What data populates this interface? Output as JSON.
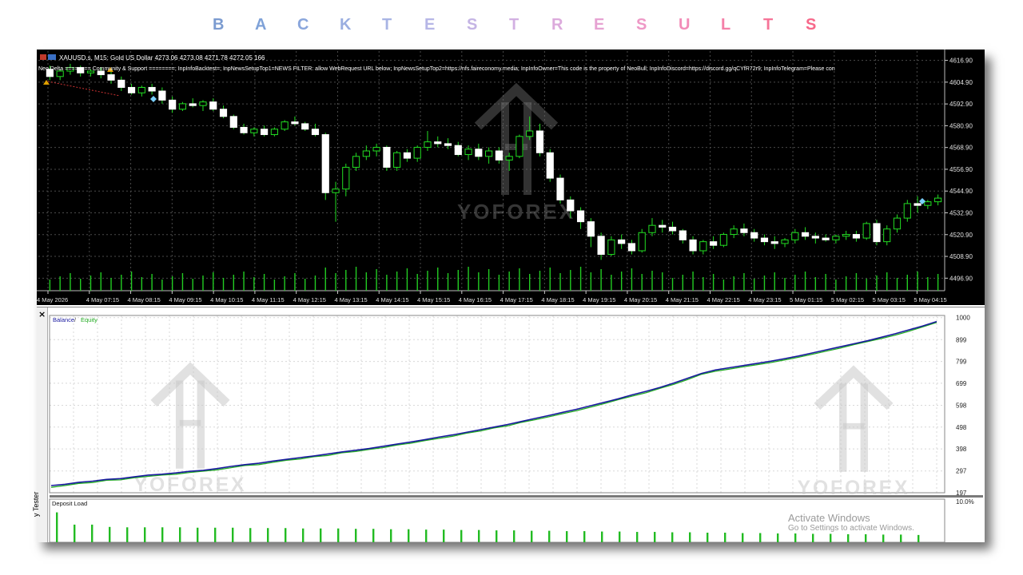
{
  "title": {
    "letters": [
      "B",
      "A",
      "C",
      "K",
      "T",
      "E",
      "S",
      "T",
      "R",
      "E",
      "S",
      "U",
      "L",
      "T",
      "S"
    ],
    "colors": [
      "#7b9bd0",
      "#7fa2d8",
      "#8aa6dc",
      "#9aaee0",
      "#a8b4e4",
      "#b6b6e6",
      "#c4b4e4",
      "#d2b0e2",
      "#dcaadc",
      "#e6a2d2",
      "#ee98c6",
      "#f28cb8",
      "#f480a8",
      "#f67498",
      "#f7688a"
    ]
  },
  "chart_header": {
    "symbol_line": "XAUUSD.s, M15:  Gold US Dollar  4273.06 4273.08 4271.78 4272.05  166",
    "info_line": "Neo Delta ======== Community & Support ========; InpInfoBacktest=; InpNewsSetupTop1=NEWS FILTER: allow WebRequest URL below; InpNewsSetupTop2=https://nfs.faireconomy.media; InpInfoOwner=This code is the property of NeoBull; InpInfoDiscord=https://discord.gg/qCYfR72r9; InpInfoTelegram=Please con"
  },
  "price_axis": {
    "ticks": [
      "4616.90",
      "4604.90",
      "4592.90",
      "4580.90",
      "4568.90",
      "4556.90",
      "4544.90",
      "4532.90",
      "4520.90",
      "4508.90",
      "4496.90"
    ]
  },
  "time_axis": {
    "ticks": [
      "4 May 2026",
      "4 May 07:15",
      "4 May 08:15",
      "4 May 09:15",
      "4 May 10:15",
      "4 May 11:15",
      "4 May 12:15",
      "4 May 13:15",
      "4 May 14:15",
      "4 May 15:15",
      "4 May 16:15",
      "4 May 17:15",
      "4 May 18:15",
      "4 May 19:15",
      "4 May 20:15",
      "4 May 21:15",
      "4 May 22:15",
      "4 May 23:15",
      "5 May 01:15",
      "5 May 02:15",
      "5 May 03:15",
      "5 May 04:15"
    ]
  },
  "equity_chart": {
    "legend_balance": "Balance",
    "legend_sep": " / ",
    "legend_equity": "Equity",
    "y_ticks": [
      "1000",
      "899",
      "799",
      "699",
      "598",
      "498",
      "398",
      "297",
      "197"
    ],
    "balance_color": "#1a1aa0",
    "equity_color": "#22aa22"
  },
  "deposit_load": {
    "label": "Deposit Load",
    "top_tick": "10.0%"
  },
  "sidebar": {
    "close_icon": "×",
    "tab_label": "y Tester"
  },
  "watermark": {
    "brand": "YOFOREX"
  },
  "activate_windows": {
    "title": "Activate Windows",
    "subtitle": "Go to Settings to activate Windows."
  },
  "chart_data": [
    {
      "type": "candlestick",
      "title": "XAUUSD.s, M15",
      "ylabel": "",
      "ylim": [
        4490,
        4622
      ],
      "grid": true,
      "candles": [
        [
          4612,
          4614,
          4606,
          4608
        ],
        [
          4608,
          4612,
          4606,
          4611
        ],
        [
          4611,
          4615,
          4609,
          4613
        ],
        [
          4613,
          4614,
          4608,
          4610
        ],
        [
          4610,
          4612,
          4608,
          4611
        ],
        [
          4611,
          4613,
          4607,
          4609
        ],
        [
          4609,
          4611,
          4604,
          4606
        ],
        [
          4606,
          4608,
          4600,
          4602
        ],
        [
          4602,
          4604,
          4598,
          4599
        ],
        [
          4599,
          4603,
          4597,
          4602
        ],
        [
          4602,
          4604,
          4598,
          4600
        ],
        [
          4600,
          4602,
          4593,
          4595
        ],
        [
          4595,
          4597,
          4588,
          4590
        ],
        [
          4590,
          4594,
          4589,
          4593
        ],
        [
          4593,
          4596,
          4591,
          4592
        ],
        [
          4592,
          4595,
          4589,
          4594
        ],
        [
          4594,
          4596,
          4589,
          4590
        ],
        [
          4590,
          4592,
          4585,
          4586
        ],
        [
          4586,
          4587,
          4579,
          4580
        ],
        [
          4580,
          4582,
          4576,
          4577
        ],
        [
          4577,
          4580,
          4575,
          4579
        ],
        [
          4579,
          4581,
          4575,
          4576
        ],
        [
          4576,
          4580,
          4575,
          4579
        ],
        [
          4579,
          4584,
          4578,
          4583
        ],
        [
          4583,
          4586,
          4581,
          4582
        ],
        [
          4582,
          4583,
          4578,
          4579
        ],
        [
          4579,
          4582,
          4575,
          4576
        ],
        [
          4576,
          4577,
          4540,
          4544
        ],
        [
          4544,
          4550,
          4528,
          4546
        ],
        [
          4546,
          4560,
          4542,
          4558
        ],
        [
          4558,
          4566,
          4556,
          4564
        ],
        [
          4564,
          4570,
          4562,
          4567
        ],
        [
          4567,
          4571,
          4564,
          4569
        ],
        [
          4569,
          4570,
          4556,
          4558
        ],
        [
          4558,
          4567,
          4556,
          4566
        ],
        [
          4566,
          4568,
          4561,
          4563
        ],
        [
          4563,
          4570,
          4561,
          4569
        ],
        [
          4569,
          4578,
          4567,
          4572
        ],
        [
          4572,
          4575,
          4569,
          4571
        ],
        [
          4571,
          4574,
          4568,
          4570
        ],
        [
          4570,
          4572,
          4564,
          4565
        ],
        [
          4565,
          4570,
          4562,
          4568
        ],
        [
          4568,
          4571,
          4562,
          4564
        ],
        [
          4564,
          4569,
          4560,
          4567
        ],
        [
          4567,
          4569,
          4560,
          4562
        ],
        [
          4562,
          4566,
          4556,
          4564
        ],
        [
          4564,
          4576,
          4563,
          4575
        ],
        [
          4575,
          4586,
          4573,
          4578
        ],
        [
          4578,
          4582,
          4564,
          4566
        ],
        [
          4566,
          4568,
          4550,
          4552
        ],
        [
          4552,
          4554,
          4538,
          4540
        ],
        [
          4540,
          4542,
          4530,
          4534
        ],
        [
          4534,
          4536,
          4524,
          4528
        ],
        [
          4528,
          4530,
          4514,
          4520
        ],
        [
          4520,
          4522,
          4507,
          4510
        ],
        [
          4510,
          4520,
          4509,
          4518
        ],
        [
          4518,
          4521,
          4513,
          4516
        ],
        [
          4516,
          4518,
          4510,
          4512
        ],
        [
          4512,
          4524,
          4511,
          4522
        ],
        [
          4522,
          4530,
          4520,
          4526
        ],
        [
          4526,
          4529,
          4522,
          4525
        ],
        [
          4525,
          4528,
          4521,
          4523
        ],
        [
          4523,
          4524,
          4516,
          4518
        ],
        [
          4518,
          4520,
          4510,
          4512
        ],
        [
          4512,
          4518,
          4510,
          4517
        ],
        [
          4517,
          4520,
          4513,
          4515
        ],
        [
          4515,
          4522,
          4514,
          4521
        ],
        [
          4521,
          4526,
          4519,
          4524
        ],
        [
          4524,
          4527,
          4520,
          4522
        ],
        [
          4522,
          4524,
          4517,
          4519
        ],
        [
          4519,
          4521,
          4515,
          4517
        ],
        [
          4517,
          4520,
          4513,
          4516
        ],
        [
          4516,
          4519,
          4514,
          4518
        ],
        [
          4518,
          4524,
          4516,
          4522
        ],
        [
          4522,
          4525,
          4518,
          4520
        ],
        [
          4520,
          4522,
          4516,
          4519
        ],
        [
          4519,
          4521,
          4517,
          4518
        ],
        [
          4518,
          4521,
          4516,
          4520
        ],
        [
          4520,
          4523,
          4518,
          4521
        ],
        [
          4521,
          4523,
          4517,
          4519
        ],
        [
          4519,
          4528,
          4518,
          4527
        ],
        [
          4527,
          4529,
          4515,
          4517
        ],
        [
          4517,
          4526,
          4515,
          4524
        ],
        [
          4524,
          4532,
          4522,
          4530
        ],
        [
          4530,
          4540,
          4528,
          4538
        ],
        [
          4538,
          4542,
          4533,
          4537
        ],
        [
          4537,
          4540,
          4535,
          4539
        ],
        [
          4539,
          4543,
          4537,
          4541
        ]
      ]
    },
    {
      "type": "line",
      "title": "Balance / Equity",
      "ylim": [
        197,
        1010
      ],
      "series": [
        {
          "name": "Balance",
          "values": [
            230,
            236,
            245,
            250,
            258,
            262,
            270,
            278,
            282,
            288,
            295,
            300,
            308,
            318,
            326,
            332,
            342,
            350,
            358,
            366,
            375,
            384,
            392,
            400,
            410,
            420,
            430,
            440,
            452,
            462,
            474,
            486,
            498,
            510,
            524,
            538,
            552,
            566,
            580,
            596,
            612,
            628,
            646,
            662,
            680,
            700,
            722,
            744,
            760,
            770,
            780,
            790,
            800,
            812,
            824,
            838,
            852,
            866,
            880,
            894,
            910,
            926,
            944,
            962,
            982
          ]
        },
        {
          "name": "Equity",
          "values": [
            222,
            230,
            240,
            244,
            254,
            256,
            266,
            272,
            278,
            282,
            290,
            296,
            302,
            312,
            322,
            326,
            336,
            346,
            352,
            362,
            368,
            380,
            386,
            396,
            404,
            416,
            424,
            436,
            446,
            456,
            470,
            480,
            494,
            504,
            520,
            532,
            546,
            560,
            574,
            590,
            606,
            624,
            640,
            656,
            676,
            694,
            716,
            740,
            754,
            764,
            774,
            784,
            794,
            806,
            818,
            832,
            846,
            860,
            876,
            890,
            904,
            920,
            938,
            958,
            978
          ]
        }
      ]
    },
    {
      "type": "bar",
      "title": "Deposit Load",
      "ylim": [
        0,
        10
      ],
      "values": [
        7.8,
        4.6,
        4.6,
        4.0,
        3.9,
        3.9,
        3.9,
        3.9,
        3.8,
        3.8,
        3.8,
        3.7,
        3.7,
        3.7,
        3.6,
        3.6,
        3.6,
        3.5,
        3.5,
        3.4,
        3.4,
        3.3,
        3.3,
        3.2,
        3.2,
        3.1,
        3.1,
        3.0,
        3.0,
        2.9,
        2.9,
        2.8,
        2.8,
        2.7,
        2.7,
        2.6,
        2.6,
        2.5,
        2.5,
        2.4,
        2.4,
        2.3,
        2.3,
        2.2,
        2.2,
        2.1,
        2.1,
        2.0,
        2.0,
        1.9
      ]
    }
  ]
}
